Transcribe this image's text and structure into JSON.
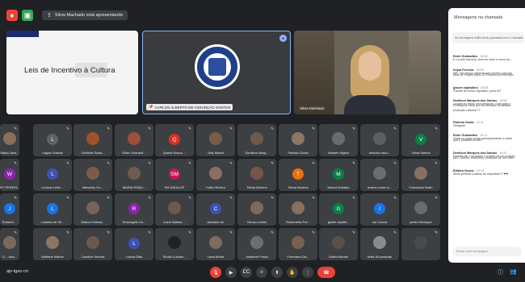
{
  "topbar": {
    "presenting_text": "Silvia Machado está apresentando"
  },
  "slide": {
    "title": "Leis de Incentivo à Cultura"
  },
  "tiles_top": {
    "carlos_name": "CARLOS ALBERTO DE ASSUNÇÃO SANTOS",
    "silvia_name": "Silvia Machado"
  },
  "grid": {
    "rows": [
      [
        {
          "name": "Maria Jaim...",
          "initial": "",
          "color": "#8a6d5b"
        },
        {
          "name": "Lagoa Grande",
          "initial": "L",
          "color": "#5f6368"
        },
        {
          "name": "Cleiciele Santi...",
          "initial": "",
          "color": "#a0522d"
        },
        {
          "name": "Ester Guimarã...",
          "initial": "",
          "color": "#9c4f3b"
        },
        {
          "name": "Queila Moura ...",
          "initial": "Q",
          "color": "#d93025"
        },
        {
          "name": "Jully Maciel",
          "initial": "",
          "color": "#7a5c48"
        },
        {
          "name": "Denilson Marq...",
          "initial": "",
          "color": "#6d5a4a"
        },
        {
          "name": "Patricia Gusta",
          "initial": "",
          "color": "#8c7765"
        },
        {
          "name": "Abiamir Higino",
          "initial": "",
          "color": "#6b6b6b"
        },
        {
          "name": "antonio rasci...",
          "initial": "",
          "color": "#5e5e5e"
        },
        {
          "name": "Vilma Santos",
          "initial": "V",
          "color": "#0b8043"
        }
      ],
      [
        {
          "name": "EY PEREIR...",
          "initial": "W",
          "color": "#8e24aa"
        },
        {
          "name": "Luciana Leão ...",
          "initial": "L",
          "color": "#3f51b5"
        },
        {
          "name": "Manuelly Gu...",
          "initial": "",
          "color": "#7b5b4b"
        },
        {
          "name": "MARIA RAQU...",
          "initial": "",
          "color": "#6e5a50"
        },
        {
          "name": "SM IDEALIZE",
          "initial": "SM",
          "color": "#c2185b"
        },
        {
          "name": "Kalla Oliveira",
          "initial": "",
          "color": "#8d6e63"
        },
        {
          "name": "Telma Moreno",
          "initial": "",
          "color": "#795548"
        },
        {
          "name": "Telma Moreira",
          "initial": "T",
          "color": "#e8710a"
        },
        {
          "name": "Marcia Dobatto",
          "initial": "M",
          "color": "#0b8043"
        },
        {
          "name": "anaine costa ol...",
          "initial": "",
          "color": "#6d6d6d"
        },
        {
          "name": "Francisele Botto",
          "initial": "",
          "color": "#8a7060"
        }
      ],
      [
        {
          "name": "Roberto ...",
          "initial": "J",
          "color": "#1a73e8"
        },
        {
          "name": "Luciana de Oli...",
          "initial": "L",
          "color": "#1a73e8"
        },
        {
          "name": "Marlos Helena...",
          "initial": "",
          "color": "#7a6355"
        },
        {
          "name": "Rosengela Ca...",
          "initial": "R",
          "color": "#8e24aa"
        },
        {
          "name": "Ivanir Batista ...",
          "initial": "",
          "color": "#6b5a4e"
        },
        {
          "name": "claudete tur",
          "initial": "C",
          "color": "#3f51b5"
        },
        {
          "name": "Geuza Lobão",
          "initial": "",
          "color": "#7d6a5d"
        },
        {
          "name": "Rosemeira Por...",
          "initial": "",
          "color": "#86705f"
        },
        {
          "name": "gisele capitel...",
          "initial": "G",
          "color": "#0b8043"
        },
        {
          "name": "Iza Cunha",
          "initial": "I",
          "color": "#1a73e8"
        },
        {
          "name": "pedro Henrique",
          "initial": "",
          "color": "#6b6b6b"
        }
      ],
      [
        {
          "name": "G ...orta...",
          "initial": "",
          "color": "#7a6a5d"
        },
        {
          "name": "Marlene Molina",
          "initial": "",
          "color": "#8c7565"
        },
        {
          "name": "Caroline Verona",
          "initial": "",
          "color": "#6b584c"
        },
        {
          "name": "Luana Dias",
          "initial": "L",
          "color": "#3f51b5"
        },
        {
          "name": "Studio Luciam...",
          "initial": "",
          "color": "#222222"
        },
        {
          "name": "Lana Motta",
          "initial": "",
          "color": "#7d6b5e"
        },
        {
          "name": "Josianne Prado",
          "initial": "",
          "color": "#6e6e6e"
        },
        {
          "name": "Francisco Da...",
          "initial": "",
          "color": "#7a6052"
        },
        {
          "name": "Marta Morais",
          "initial": "",
          "color": "#5c4f46"
        },
        {
          "name": "Mais 46 pessoas",
          "initial": "",
          "color": "#8a8a8a"
        },
        {
          "name": "",
          "initial": "",
          "color": "#4a4a4a"
        }
      ]
    ]
  },
  "bottombar": {
    "meeting_code": "ajv-tgez-cri"
  },
  "chat": {
    "title": "Mensagens na chamada",
    "notice": "As mensagens estão sendo gravadas com a chamada",
    "messages": [
      {
        "who": "Ester Guimarães",
        "when": "18:55",
        "text": "E o ponto barreira, does ter lixeir e nome du..."
      },
      {
        "who": "Keyla Ferreira",
        "when": "18:55",
        "text": "MEI, tem tempo determinado mínimo para faz"
      },
      {
        "who": "",
        "when": "",
        "text": "anos de Projeto para Lei Rouanet por exemplo"
      },
      {
        "who": "gissee capitulino",
        "when": "18:56",
        "text": "Grande de forma capitulino, juma MT"
      },
      {
        "who": "Denilson Marques dos Santos",
        "when": "18:56",
        "text": "Lucana eu tenho uma pergunta: Gara para o"
      },
      {
        "who": "",
        "when": "",
        "text": "Professora Silvia por um exemplo de sessao"
      },
      {
        "who": "",
        "when": "",
        "text": "produção cultural???"
      },
      {
        "who": "Patricia Gusta",
        "when": "19:11",
        "text": "Obrigada"
      },
      {
        "who": "Ester Guimarães",
        "when": "19:11",
        "text": "Onde eu posso achar acompanhando o edital"
      },
      {
        "who": "",
        "when": "",
        "text": "que é postado no site?"
      },
      {
        "who": "Denilson Marques dos Santos",
        "when": "19:11",
        "text": "Estarão lab o incubado a criação de um produto"
      },
      {
        "who": "",
        "when": "",
        "text": "livro, Oficina, Workshop, produção de um vídeo"
      },
      {
        "who": "Edluira Gusca",
        "when": "19:13",
        "text": "Muito perfeita a classe as respostas?? ❤❤"
      }
    ],
    "input_placeholder": "Enviar uma mensagem"
  },
  "icons": {
    "mic": "mic-icon",
    "cam": "camera-icon",
    "end": "end-call-icon"
  }
}
